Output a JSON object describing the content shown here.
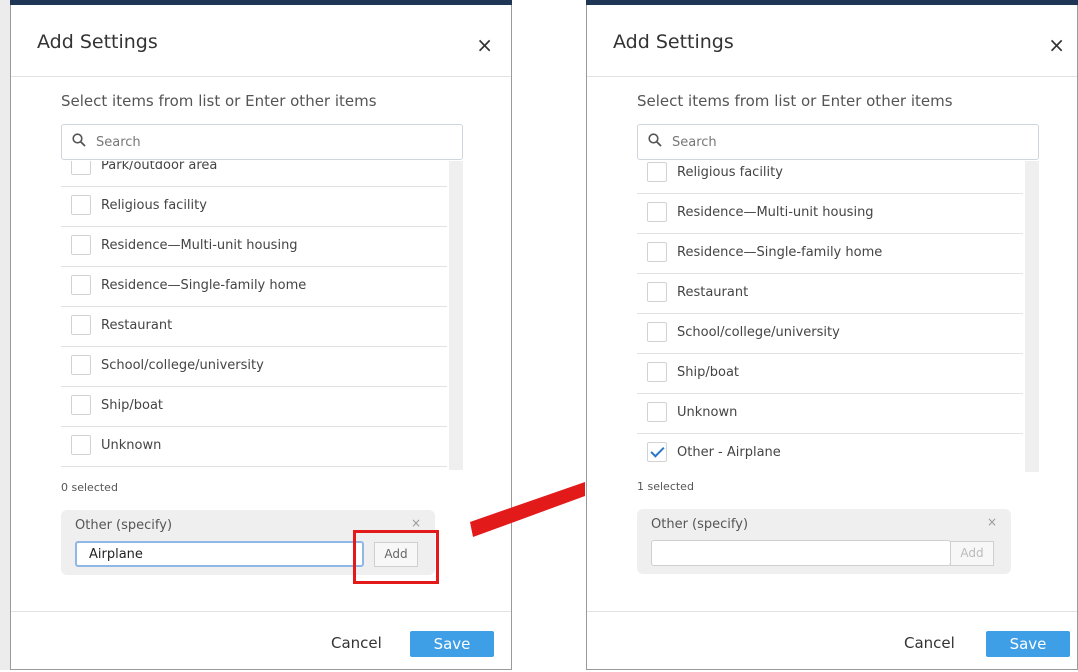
{
  "left": {
    "title": "Add Settings",
    "close_glyph": "×",
    "subtitle": "Select items from list or Enter other items",
    "search_placeholder": "Search",
    "items": [
      {
        "label": "Park/outdoor area",
        "checked": false
      },
      {
        "label": "Religious facility",
        "checked": false
      },
      {
        "label": "Residence—Multi-unit housing",
        "checked": false
      },
      {
        "label": "Residence—Single-family home",
        "checked": false
      },
      {
        "label": "Restaurant",
        "checked": false
      },
      {
        "label": "School/college/university",
        "checked": false
      },
      {
        "label": "Ship/boat",
        "checked": false
      },
      {
        "label": "Unknown",
        "checked": false
      }
    ],
    "selected_count": "0 selected",
    "other_label": "Other (specify)",
    "other_clear": "×",
    "other_value": "Airplane",
    "add_label": "Add",
    "cancel_label": "Cancel",
    "save_label": "Save"
  },
  "right": {
    "title": "Add Settings",
    "close_glyph": "×",
    "subtitle": "Select items from list or Enter other items",
    "search_placeholder": "Search",
    "items": [
      {
        "label": "Religious facility",
        "checked": false
      },
      {
        "label": "Residence—Multi-unit housing",
        "checked": false
      },
      {
        "label": "Residence—Single-family home",
        "checked": false
      },
      {
        "label": "Restaurant",
        "checked": false
      },
      {
        "label": "School/college/university",
        "checked": false
      },
      {
        "label": "Ship/boat",
        "checked": false
      },
      {
        "label": "Unknown",
        "checked": false
      },
      {
        "label": "Other - Airplane",
        "checked": true
      }
    ],
    "selected_count": "1 selected",
    "other_label": "Other (specify)",
    "other_clear": "×",
    "other_value": "",
    "add_label": "Add",
    "cancel_label": "Cancel",
    "save_label": "Save"
  },
  "colors": {
    "accent": "#3e9ee6",
    "annotation": "#e21a1a",
    "header_bar": "#1f3556"
  },
  "icons": [
    "search-icon",
    "close-icon",
    "check-icon",
    "arrow-annotation"
  ]
}
